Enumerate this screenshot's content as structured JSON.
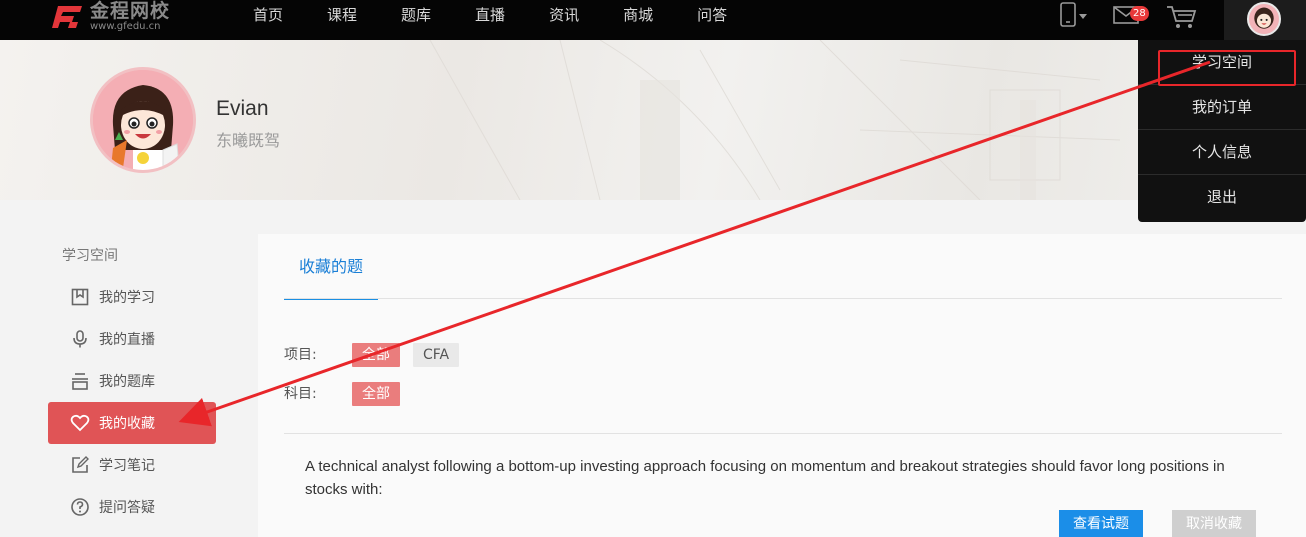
{
  "header": {
    "logo_text": "金程网校",
    "logo_url": "www.gfedu.cn",
    "nav": [
      "首页",
      "课程",
      "题库",
      "直播",
      "资讯",
      "商城",
      "问答"
    ],
    "message_count": "28"
  },
  "profile": {
    "name": "Evian",
    "subtitle": "东曦既驾"
  },
  "dropdown": {
    "items": [
      "学习空间",
      "我的订单",
      "个人信息",
      "退出"
    ],
    "highlight_color": "#e8262a"
  },
  "sidebar": {
    "title": "学习空间",
    "items": [
      {
        "label": "我的学习",
        "icon": "bookmark-icon"
      },
      {
        "label": "我的直播",
        "icon": "microphone-icon"
      },
      {
        "label": "我的题库",
        "icon": "question-bank-icon"
      },
      {
        "label": "我的收藏",
        "icon": "heart-icon",
        "active": true
      },
      {
        "label": "学习笔记",
        "icon": "edit-icon"
      },
      {
        "label": "提问答疑",
        "icon": "question-icon"
      }
    ],
    "active_color": "#e05456"
  },
  "main": {
    "tab": "收藏的题",
    "filters": {
      "project_label": "项目:",
      "project_options": [
        "全部",
        "CFA"
      ],
      "subject_label": "科目:",
      "subject_options": [
        "全部"
      ]
    },
    "question": "A technical analyst following a bottom-up investing approach focusing on momentum and breakout strategies should favor long positions in stocks with:",
    "view_button": "查看试题",
    "cancel_button": "取消收藏",
    "accent": "#1b8ee8"
  }
}
